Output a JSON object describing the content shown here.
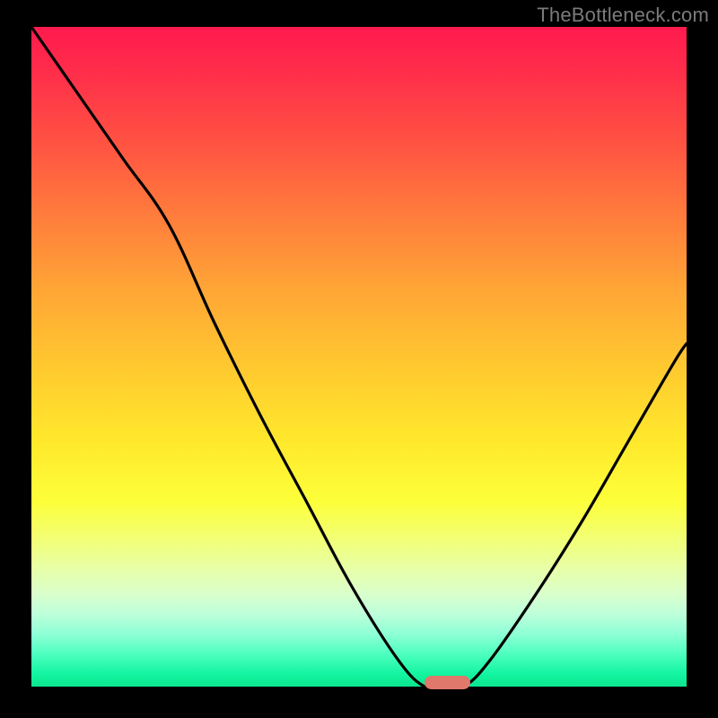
{
  "watermark": "TheBottleneck.com",
  "colors": {
    "frame_bg": "#000000",
    "marker": "#e0786b",
    "curve": "#000000",
    "gradient_top": "#ff1a4e",
    "gradient_bottom": "#0be68f"
  },
  "chart_data": {
    "type": "line",
    "title": "",
    "xlabel": "",
    "ylabel": "",
    "xlim": [
      0,
      100
    ],
    "ylim": [
      0,
      100
    ],
    "grid": false,
    "legend": false,
    "background": "red-to-green vertical gradient (bottleneck heatmap)",
    "series": [
      {
        "name": "bottleneck-curve",
        "x": [
          0,
          7,
          14,
          21,
          28,
          35,
          42,
          49,
          56,
          60,
          63,
          66,
          70,
          77,
          84,
          91,
          98,
          100
        ],
        "values": [
          100,
          90,
          80,
          70,
          55,
          41,
          28,
          15,
          4,
          0,
          0,
          0,
          4,
          14,
          25,
          37,
          49,
          52
        ]
      }
    ],
    "marker": {
      "name": "optimal-zone",
      "x_start": 60,
      "x_end": 67,
      "y": 0
    },
    "annotations": []
  }
}
